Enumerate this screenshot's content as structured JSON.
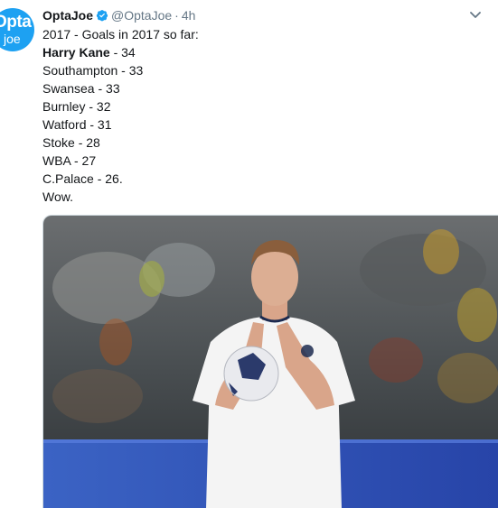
{
  "tweet": {
    "author_name": "OptaJoe",
    "handle": "@OptaJoe",
    "separator": "·",
    "time": "4h",
    "avatar_lines": [
      "Opta",
      "joe"
    ],
    "lines": [
      {
        "text": "2017 - Goals in 2017 so far:",
        "bold": false
      },
      {
        "text": "Harry Kane",
        "bold": true,
        "suffix": " - 34"
      },
      {
        "text": "Southampton - 33",
        "bold": false
      },
      {
        "text": "Swansea - 33",
        "bold": false
      },
      {
        "text": "Burnley - 32",
        "bold": false
      },
      {
        "text": "Watford - 31",
        "bold": false
      },
      {
        "text": "Stoke - 28",
        "bold": false
      },
      {
        "text": "WBA - 27",
        "bold": false
      },
      {
        "text": "C.Palace - 26.",
        "bold": false
      },
      {
        "text": "Wow.",
        "bold": false
      }
    ],
    "photo": {
      "subject": "footballer applauding holding match ball",
      "shirt_color": "#f4f4f4",
      "background_color": "#3a3f44",
      "board_color": "#2b5cc9"
    },
    "colors": {
      "verified": "#1da1f2",
      "muted": "#657786",
      "text": "#14171a"
    },
    "icons": {
      "verified": "verified-badge-icon",
      "menu": "chevron-down-icon"
    }
  }
}
